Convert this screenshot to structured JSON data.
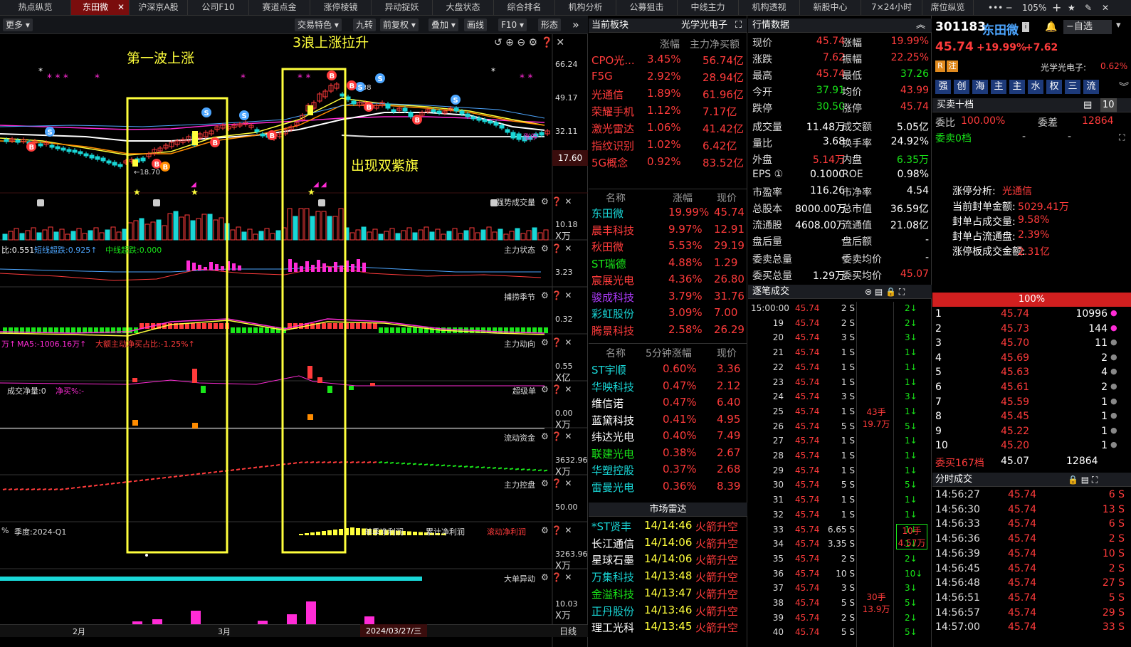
{
  "topbar": {
    "tabs": [
      "热点纵览",
      "东田微",
      "沪深京A股",
      "公司F10",
      "赛道点金",
      "涨停棱镜",
      "异动捉妖",
      "大盘状态",
      "综合排名",
      "机构分析",
      "公募狙击",
      "中线主力",
      "机构透视",
      "新股中心",
      "7×24小时",
      "席位纵览"
    ],
    "active_close": "✕",
    "zoom": "105%",
    "controls": [
      "•••",
      "─",
      "+",
      "★",
      "✎",
      "✕"
    ]
  },
  "toolbar": {
    "more": "更多",
    "items": [
      "交易特色",
      "九转",
      "前复权",
      "叠加",
      "画线",
      "F10",
      "形态"
    ]
  },
  "annotations": {
    "wave1": "第一波上涨",
    "wave3": "3浪上涨拉升",
    "flag": "出现双紫旗"
  },
  "kline": {
    "axis": [
      "66.24",
      "49.17",
      "32.11"
    ],
    "current_badge": "17.60",
    "low_label": "18.70",
    "high_label": "65.38",
    "limit_tag": "涨停"
  },
  "panels": [
    {
      "name": "强势成交量",
      "axis": "10.18",
      "unit": "X万"
    },
    {
      "name": "主力状态",
      "axis": "3.23",
      "legend": [
        "比:0.551",
        "短线超跌:0.925↑",
        "中线超跌:0.000"
      ]
    },
    {
      "name": "捕捞季节",
      "axis": "0.32"
    },
    {
      "name": "主力动向",
      "axis": "0.55",
      "unit": "X亿",
      "legend": [
        "万↑",
        "MA5:-1006.16万↑",
        "大额主动净买占比:-1.25%↑"
      ]
    },
    {
      "name": "超级单",
      "axis": "0.00",
      "unit": "X万",
      "legend": [
        "成交净量:0",
        "净买%:-"
      ]
    },
    {
      "name": "流动资金",
      "axis": "3632.96",
      "unit": "X万"
    },
    {
      "name": "主力控盘",
      "axis": "50.00"
    },
    {
      "name": "季度",
      "axis": "3263.96",
      "unit": "X万",
      "legend": [
        "%",
        "季度:2024-Q1"
      ],
      "tabs": [
        "单季净利润",
        "累计净利润",
        "滚动净利润"
      ]
    },
    {
      "name": "大单异动",
      "axis": "10.03",
      "unit": "X万"
    }
  ],
  "xaxis": {
    "labels": [
      "2月",
      "3月"
    ],
    "date": "2024/03/27/三",
    "period": "日线"
  },
  "sector": {
    "title": "当前板块",
    "name": "光学光电子",
    "cols": [
      "涨幅",
      "主力净买额"
    ],
    "rows": [
      [
        "CPO光...",
        "3.45%",
        "56.74亿"
      ],
      [
        "F5G",
        "2.92%",
        "28.94亿"
      ],
      [
        "光通信",
        "1.89%",
        "61.96亿"
      ],
      [
        "荣耀手机",
        "1.12%",
        "7.17亿"
      ],
      [
        "激光雷达",
        "1.06%",
        "41.42亿"
      ],
      [
        "指纹识别",
        "1.02%",
        "6.42亿"
      ],
      [
        "5G概念",
        "0.92%",
        "83.52亿"
      ]
    ]
  },
  "peers": {
    "cols": [
      "名称",
      "涨幅",
      "现价"
    ],
    "rows": [
      [
        "东田微",
        "19.99%",
        "45.74"
      ],
      [
        "晨丰科技",
        "9.97%",
        "12.91"
      ],
      [
        "秋田微",
        "5.53%",
        "29.19"
      ],
      [
        "ST瑞德",
        "4.88%",
        "1.29"
      ],
      [
        "宸展光电",
        "4.36%",
        "26.80"
      ],
      [
        "骏成科技",
        "3.79%",
        "31.76"
      ],
      [
        "彩虹股份",
        "3.09%",
        "7.00"
      ],
      [
        "腾景科技",
        "2.58%",
        "26.29"
      ]
    ]
  },
  "fivemin": {
    "cols": [
      "名称",
      "5分钟涨幅",
      "现价"
    ],
    "rows": [
      [
        "ST宇顺",
        "0.60%",
        "3.36"
      ],
      [
        "华映科技",
        "0.47%",
        "2.12"
      ],
      [
        "维信诺",
        "0.47%",
        "6.40"
      ],
      [
        "蓝黛科技",
        "0.41%",
        "4.95"
      ],
      [
        "纬达光电",
        "0.40%",
        "7.49"
      ],
      [
        "联建光电",
        "0.38%",
        "2.67"
      ],
      [
        "华塑控股",
        "0.37%",
        "2.68"
      ],
      [
        "雷曼光电",
        "0.36%",
        "8.39"
      ]
    ]
  },
  "radar": {
    "title": "市场雷达",
    "rows": [
      [
        "*ST贤丰",
        "14/14:46",
        "火箭升空"
      ],
      [
        "长江通信",
        "14/14:06",
        "火箭升空"
      ],
      [
        "星球石墨",
        "14/14:06",
        "火箭升空"
      ],
      [
        "万集科技",
        "14/13:48",
        "火箭升空"
      ],
      [
        "金溢科技",
        "14/13:47",
        "火箭升空"
      ],
      [
        "正丹股份",
        "14/13:46",
        "火箭升空"
      ],
      [
        "理工光科",
        "14/13:45",
        "火箭升空"
      ]
    ]
  },
  "quote": {
    "title": "行情数据",
    "rows": [
      [
        "现价",
        "45.74",
        "涨幅",
        "19.99%"
      ],
      [
        "涨跌",
        "7.62",
        "振幅",
        "22.25%"
      ],
      [
        "最高",
        "45.74",
        "最低",
        "37.26"
      ],
      [
        "今开",
        "37.91",
        "均价",
        "43.99"
      ],
      [
        "跌停",
        "30.50",
        "涨停",
        "45.74"
      ],
      [
        "成交量",
        "11.48万",
        "成交额",
        "5.05亿"
      ],
      [
        "量比",
        "3.68",
        "换手率",
        "24.92%"
      ],
      [
        "外盘",
        "5.14万",
        "内盘",
        "6.35万"
      ],
      [
        "EPS ①",
        "0.1000",
        "ROE",
        "0.98%"
      ],
      [
        "市盈率",
        "116.26",
        "市净率",
        "4.54"
      ],
      [
        "总股本",
        "8000.00万",
        "总市值",
        "36.59亿"
      ],
      [
        "流通股",
        "4608.00万",
        "流通值",
        "21.08亿"
      ],
      [
        "盘后量",
        "-",
        "盘后额",
        "-"
      ],
      [
        "委卖总量",
        "-",
        "委卖均价",
        "-"
      ],
      [
        "委买总量",
        "1.29万",
        "委买均价",
        "45.07"
      ]
    ]
  },
  "ticks": {
    "title": "逐笔成交",
    "rows": [
      [
        "15:00:00",
        "45.74",
        "2 S",
        "2"
      ],
      [
        "19",
        "45.74",
        "2 S",
        "2"
      ],
      [
        "20",
        "45.74",
        "3 S",
        "3"
      ],
      [
        "21",
        "45.74",
        "1 S",
        "1"
      ],
      [
        "22",
        "45.74",
        "1 S",
        "1"
      ],
      [
        "23",
        "45.74",
        "1 S",
        "1"
      ],
      [
        "24",
        "45.74",
        "3 S",
        "3"
      ],
      [
        "25",
        "45.74",
        "1 S",
        "1"
      ],
      [
        "26",
        "45.74",
        "5 S",
        "5"
      ],
      [
        "27",
        "45.74",
        "1 S",
        "1"
      ],
      [
        "28",
        "45.74",
        "1 S",
        "1"
      ],
      [
        "29",
        "45.74",
        "1 S",
        "1"
      ],
      [
        "30",
        "45.74",
        "5 S",
        "5"
      ],
      [
        "31",
        "45.74",
        "1 S",
        "1"
      ],
      [
        "32",
        "45.74",
        "1 S",
        "1"
      ],
      [
        "33",
        "45.74",
        "6.65 S",
        "1"
      ],
      [
        "34",
        "45.74",
        "3.35 S",
        "1"
      ],
      [
        "35",
        "45.74",
        "2 S",
        "2"
      ],
      [
        "36",
        "45.74",
        "10 S",
        "10"
      ],
      [
        "37",
        "45.74",
        "3 S",
        "3"
      ],
      [
        "38",
        "45.74",
        "5 S",
        "5"
      ],
      [
        "39",
        "45.74",
        "2 S",
        "2"
      ],
      [
        "40",
        "45.74",
        "5 S",
        "5"
      ]
    ],
    "blocks": [
      [
        "43手",
        "19.7万"
      ],
      [
        "10手",
        "4.57万"
      ],
      [
        "30手",
        "13.9万"
      ]
    ]
  },
  "stock": {
    "code": "301183",
    "name": "东田微",
    "price": "45.74",
    "pct": "+19.99%",
    "chg": "+7.62",
    "select_btn": "自选",
    "sector_label": "光学光电子:",
    "sector_pct": "0.62%",
    "tags": [
      "R",
      "注"
    ],
    "tag_buttons": [
      "强",
      "创",
      "海",
      "主",
      "主",
      "水",
      "权",
      "三",
      "流"
    ]
  },
  "orderbook": {
    "title": "买卖十档",
    "wb_label": "委比",
    "wb": "100.00%",
    "wc_label": "委差",
    "wc": "12864",
    "sell_label": "委卖0档",
    "sell_dashes": [
      "-",
      "-"
    ],
    "analysis_title": "涨停分析:",
    "analysis_sector": "光通信",
    "analysis": [
      [
        "当前封单金额:",
        "5029.41万"
      ],
      [
        "封单占成交量:",
        "9.58%"
      ],
      [
        "封单占流通盘:",
        "2.39%"
      ],
      [
        "涨停板成交金额:",
        "2.31亿"
      ]
    ],
    "pct_bar": "100%",
    "buys": [
      [
        "1",
        "45.74",
        "10996"
      ],
      [
        "2",
        "45.73",
        "144"
      ],
      [
        "3",
        "45.70",
        "11"
      ],
      [
        "4",
        "45.69",
        "2"
      ],
      [
        "5",
        "45.63",
        "4"
      ],
      [
        "6",
        "45.61",
        "2"
      ],
      [
        "7",
        "45.59",
        "1"
      ],
      [
        "8",
        "45.45",
        "1"
      ],
      [
        "9",
        "45.22",
        "1"
      ],
      [
        "10",
        "45.20",
        "1"
      ]
    ],
    "buy_total": [
      "委买167档",
      "45.07",
      "12864"
    ]
  },
  "intraday": {
    "title": "分时成交",
    "rows": [
      [
        "14:56:27",
        "45.74",
        "6 S"
      ],
      [
        "14:56:30",
        "45.74",
        "13 S"
      ],
      [
        "14:56:33",
        "45.74",
        "6 S"
      ],
      [
        "14:56:36",
        "45.74",
        "2 S"
      ],
      [
        "14:56:39",
        "45.74",
        "10 S"
      ],
      [
        "14:56:45",
        "45.74",
        "2 S"
      ],
      [
        "14:56:48",
        "45.74",
        "27 S"
      ],
      [
        "14:56:51",
        "45.74",
        "5 S"
      ],
      [
        "14:56:57",
        "45.74",
        "29 S"
      ],
      [
        "14:57:00",
        "45.74",
        "33 S"
      ]
    ]
  },
  "colors": {
    "up": "#ff3b3b",
    "down": "#19e619",
    "accent": "#ffff3c",
    "cyan": "#19d6d6",
    "tabActive": "#7a0d0d",
    "bg": "#000000"
  }
}
